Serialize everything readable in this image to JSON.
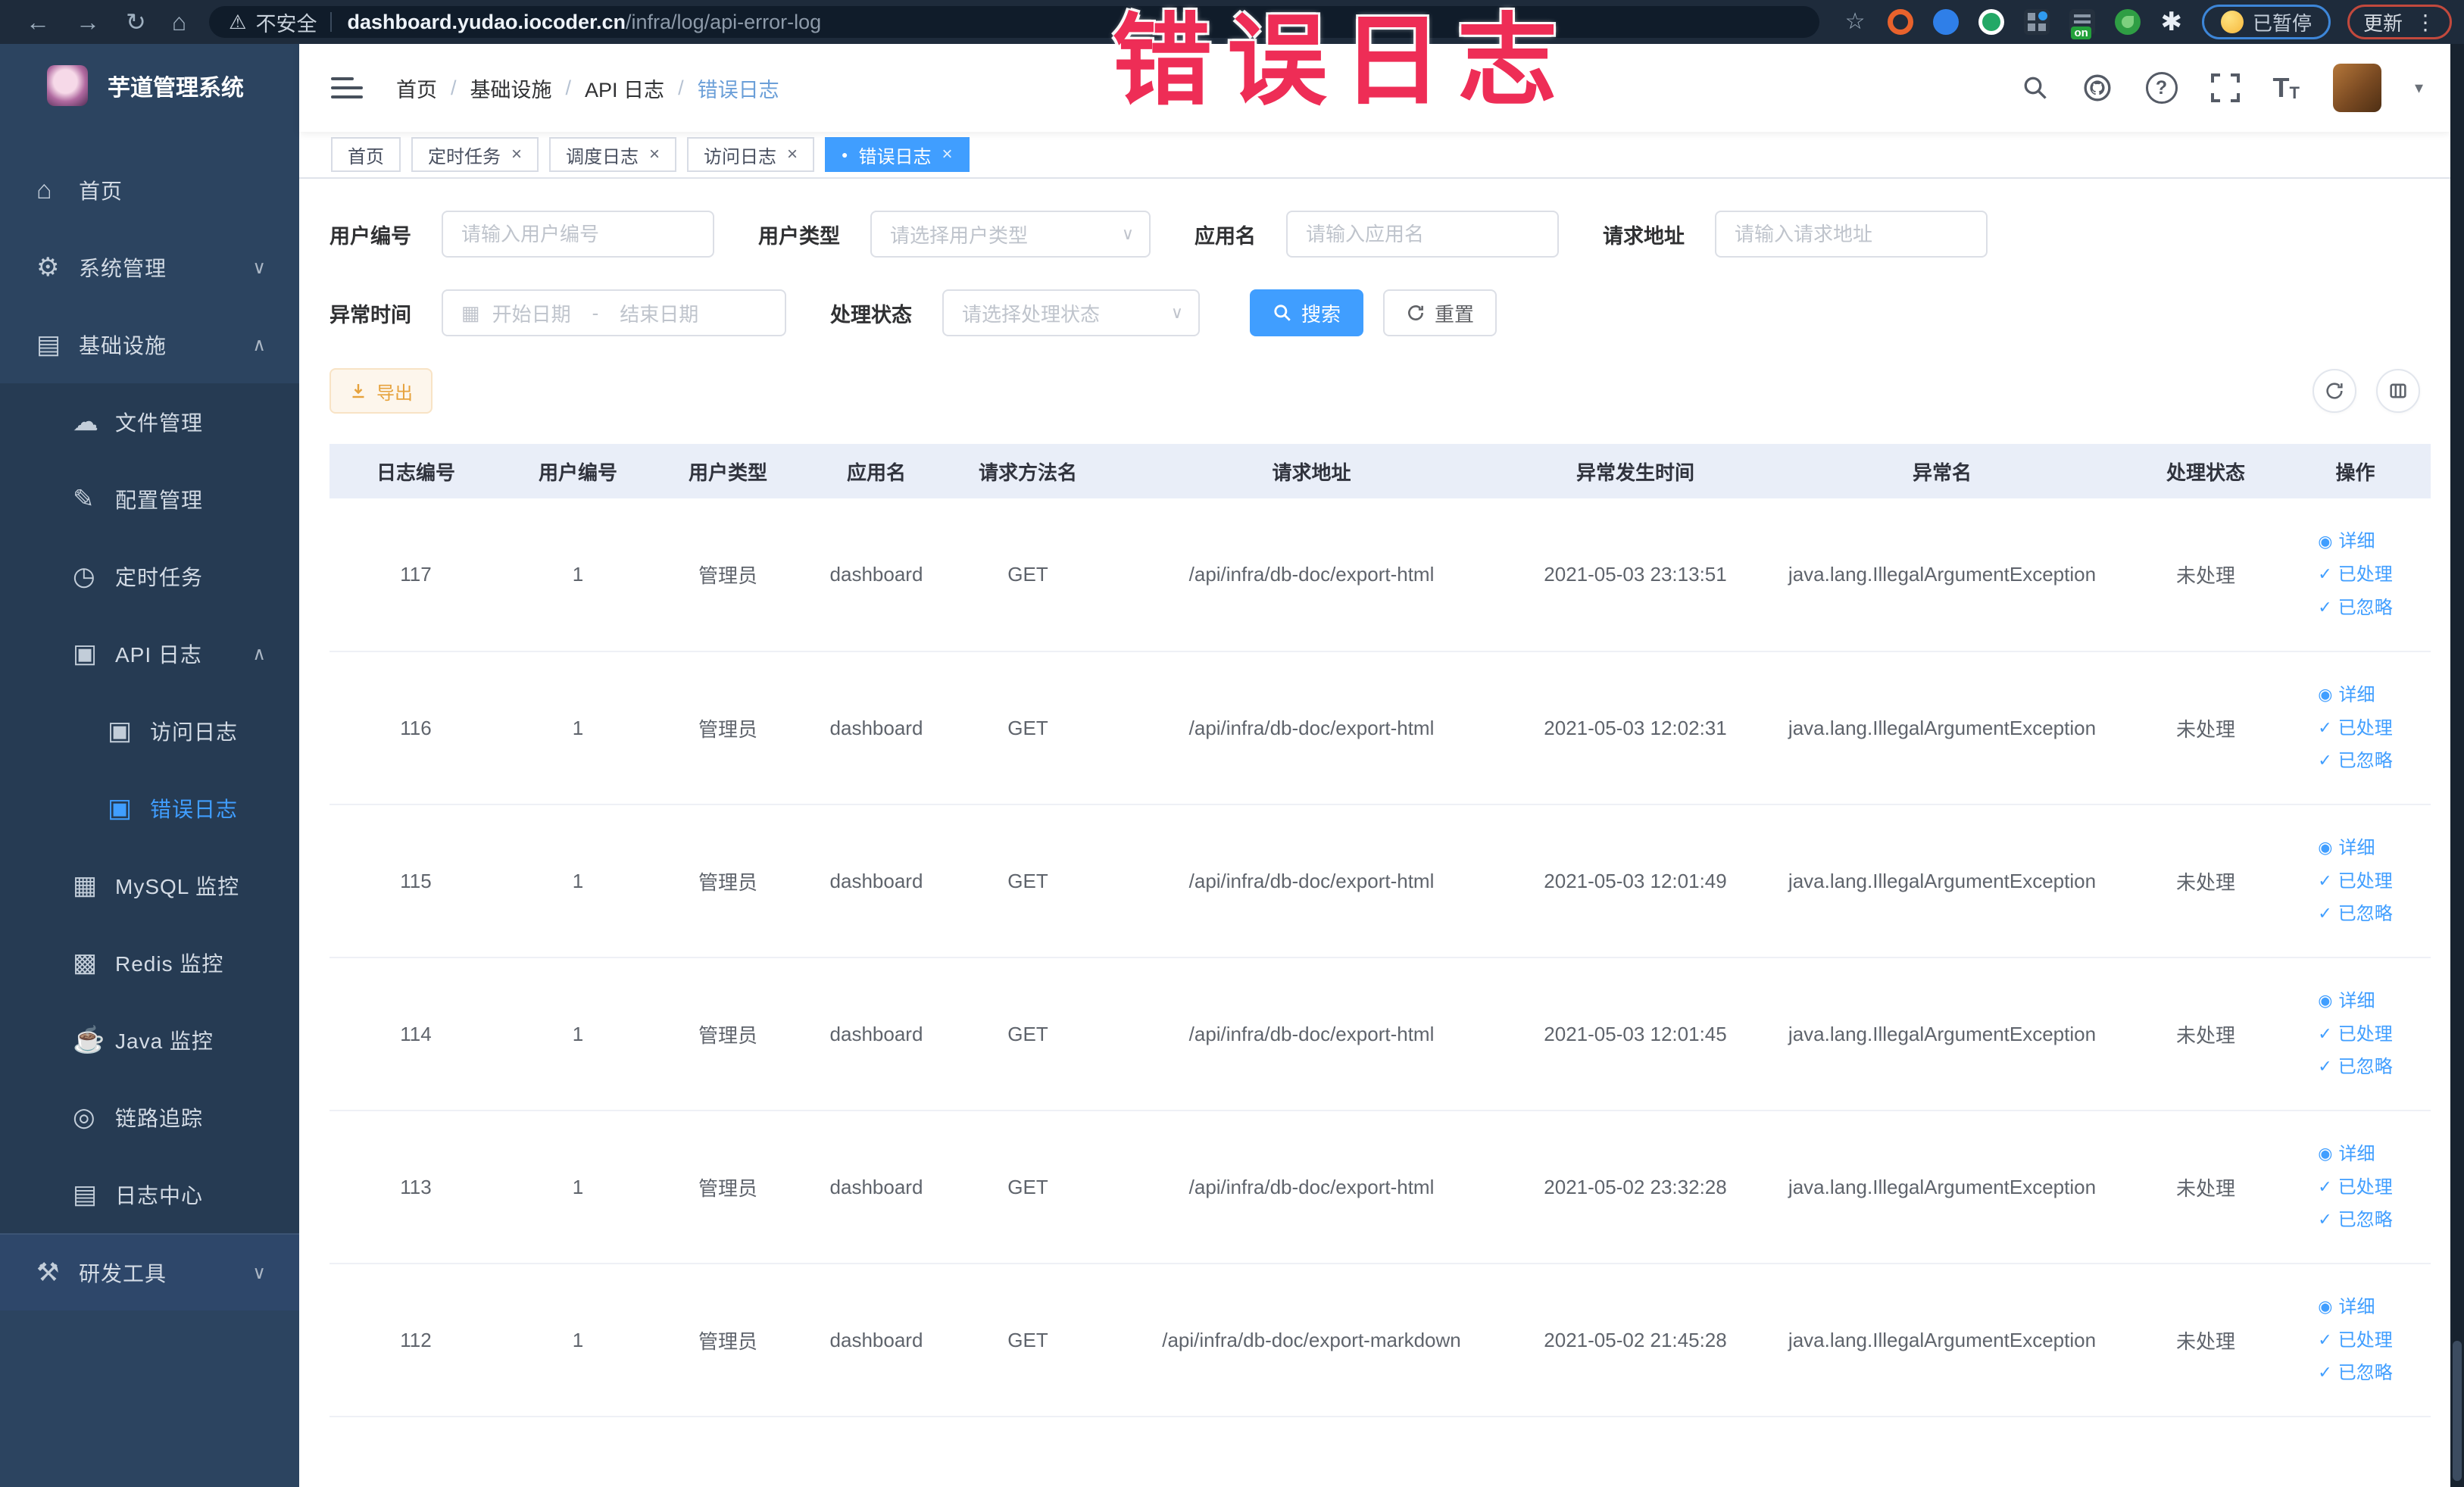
{
  "theme": {
    "accent_blue": "#409eff",
    "warning_orange": "#e6a23c",
    "overlay_red": "#ee2d56",
    "sidebar_bg": "#2c4460",
    "submenu_bg": "#263b53",
    "chrome_bg": "#1e2b3b",
    "table_header_bg": "#e9eef8"
  },
  "glyphs": {
    "back": "←",
    "forward": "→",
    "reload": "↻",
    "home": "⌂",
    "warning": "⚠",
    "star": "☆",
    "menu_dots": "⋮",
    "caret_down": "▾",
    "chevron_down": "∨",
    "chevron_up": "∧",
    "close": "×",
    "dot": "●",
    "eye": "◉",
    "check": "✓",
    "calendar": "▦",
    "select_arrow": "∨",
    "question": "?",
    "font": "T",
    "icons": {
      "home": "⌂",
      "gear": "⚙",
      "monitor": "▤",
      "upload-cloud": "☁",
      "edit": "✎",
      "timer": "◷",
      "log": "▣",
      "chart": "▦",
      "stack": "▩",
      "coffee": "☕",
      "eye": "◎",
      "document": "▤",
      "tools": "⚒"
    }
  },
  "browser": {
    "security_label": "不安全",
    "url_domain": "dashboard.yudao.iocoder.cn",
    "url_path": "/infra/log/api-error-log",
    "extension_badge": "on",
    "paused_label": "已暂停",
    "update_label": "更新"
  },
  "overlay": {
    "title": "错误日志"
  },
  "sidebar": {
    "app_title": "芋道管理系统",
    "items": [
      {
        "key": "home",
        "icon": "home",
        "label": "首页",
        "level": 0
      },
      {
        "key": "system",
        "icon": "gear",
        "label": "系统管理",
        "level": 0,
        "arrow": "down"
      },
      {
        "key": "infra",
        "icon": "monitor",
        "label": "基础设施",
        "level": 0,
        "arrow": "up"
      },
      {
        "key": "file",
        "icon": "upload-cloud",
        "label": "文件管理",
        "level": 1
      },
      {
        "key": "config",
        "icon": "edit",
        "label": "配置管理",
        "level": 1
      },
      {
        "key": "job",
        "icon": "timer",
        "label": "定时任务",
        "level": 1
      },
      {
        "key": "api-log",
        "icon": "log",
        "label": "API 日志",
        "level": 1,
        "arrow": "up"
      },
      {
        "key": "access-log",
        "icon": "log",
        "label": "访问日志",
        "level": 2
      },
      {
        "key": "error-log",
        "icon": "log",
        "label": "错误日志",
        "level": 2,
        "active": true
      },
      {
        "key": "mysql",
        "icon": "chart",
        "label": "MySQL 监控",
        "level": 1
      },
      {
        "key": "redis",
        "icon": "stack",
        "label": "Redis 监控",
        "level": 1
      },
      {
        "key": "java",
        "icon": "coffee",
        "label": "Java 监控",
        "level": 1
      },
      {
        "key": "tracer",
        "icon": "eye",
        "label": "链路追踪",
        "level": 1
      },
      {
        "key": "log-center",
        "icon": "document",
        "label": "日志中心",
        "level": 1
      },
      {
        "key": "dev-tools",
        "icon": "tools",
        "label": "研发工具",
        "level": 0,
        "arrow": "down"
      }
    ]
  },
  "header": {
    "breadcrumb": [
      "首页",
      "基础设施",
      "API 日志",
      "错误日志"
    ]
  },
  "tabs": [
    {
      "key": "home",
      "label": "首页",
      "closable": false,
      "active": false
    },
    {
      "key": "job",
      "label": "定时任务",
      "closable": true,
      "active": false
    },
    {
      "key": "job-log",
      "label": "调度日志",
      "closable": true,
      "active": false
    },
    {
      "key": "access-log",
      "label": "访问日志",
      "closable": true,
      "active": false
    },
    {
      "key": "error-log",
      "label": "错误日志",
      "closable": true,
      "active": true
    }
  ],
  "filters": {
    "user_id": {
      "label": "用户编号",
      "placeholder": "请输入用户编号"
    },
    "user_type": {
      "label": "用户类型",
      "placeholder": "请选择用户类型"
    },
    "app_name": {
      "label": "应用名",
      "placeholder": "请输入应用名"
    },
    "request_url": {
      "label": "请求地址",
      "placeholder": "请输入请求地址"
    },
    "exception_time": {
      "label": "异常时间",
      "start_placeholder": "开始日期",
      "separator": "-",
      "end_placeholder": "结束日期"
    },
    "process_status": {
      "label": "处理状态",
      "placeholder": "请选择处理状态"
    },
    "search_label": "搜索",
    "reset_label": "重置"
  },
  "toolbar": {
    "export_label": "导出"
  },
  "table": {
    "columns": [
      "日志编号",
      "用户编号",
      "用户类型",
      "应用名",
      "请求方法名",
      "请求地址",
      "异常发生时间",
      "异常名",
      "处理状态",
      "操作"
    ],
    "action_labels": {
      "detail": "详细",
      "processed": "已处理",
      "ignored": "已忽略"
    },
    "rows": [
      {
        "id": "117",
        "user_id": "1",
        "user_type": "管理员",
        "app_name": "dashboard",
        "method": "GET",
        "url": "/api/infra/db-doc/export-html",
        "time": "2021-05-03 23:13:51",
        "exception": "java.lang.IllegalArgumentException",
        "status": "未处理"
      },
      {
        "id": "116",
        "user_id": "1",
        "user_type": "管理员",
        "app_name": "dashboard",
        "method": "GET",
        "url": "/api/infra/db-doc/export-html",
        "time": "2021-05-03 12:02:31",
        "exception": "java.lang.IllegalArgumentException",
        "status": "未处理"
      },
      {
        "id": "115",
        "user_id": "1",
        "user_type": "管理员",
        "app_name": "dashboard",
        "method": "GET",
        "url": "/api/infra/db-doc/export-html",
        "time": "2021-05-03 12:01:49",
        "exception": "java.lang.IllegalArgumentException",
        "status": "未处理"
      },
      {
        "id": "114",
        "user_id": "1",
        "user_type": "管理员",
        "app_name": "dashboard",
        "method": "GET",
        "url": "/api/infra/db-doc/export-html",
        "time": "2021-05-03 12:01:45",
        "exception": "java.lang.IllegalArgumentException",
        "status": "未处理"
      },
      {
        "id": "113",
        "user_id": "1",
        "user_type": "管理员",
        "app_name": "dashboard",
        "method": "GET",
        "url": "/api/infra/db-doc/export-html",
        "time": "2021-05-02 23:32:28",
        "exception": "java.lang.IllegalArgumentException",
        "status": "未处理"
      },
      {
        "id": "112",
        "user_id": "1",
        "user_type": "管理员",
        "app_name": "dashboard",
        "method": "GET",
        "url": "/api/infra/db-doc/export-markdown",
        "time": "2021-05-02 21:45:28",
        "exception": "java.lang.IllegalArgumentException",
        "status": "未处理"
      }
    ]
  }
}
